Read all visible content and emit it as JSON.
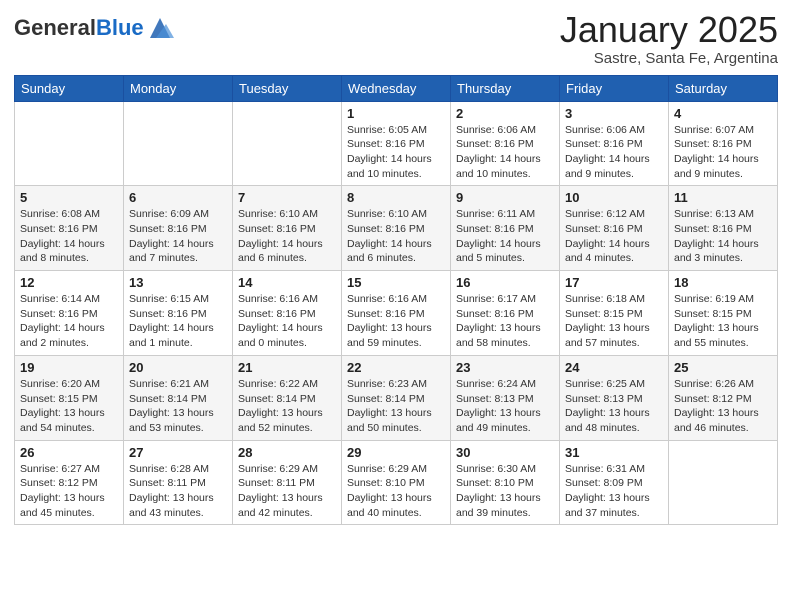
{
  "logo": {
    "general": "General",
    "blue": "Blue"
  },
  "title": "January 2025",
  "location": "Sastre, Santa Fe, Argentina",
  "days_of_week": [
    "Sunday",
    "Monday",
    "Tuesday",
    "Wednesday",
    "Thursday",
    "Friday",
    "Saturday"
  ],
  "weeks": [
    [
      {
        "day": "",
        "info": ""
      },
      {
        "day": "",
        "info": ""
      },
      {
        "day": "",
        "info": ""
      },
      {
        "day": "1",
        "info": "Sunrise: 6:05 AM\nSunset: 8:16 PM\nDaylight: 14 hours\nand 10 minutes."
      },
      {
        "day": "2",
        "info": "Sunrise: 6:06 AM\nSunset: 8:16 PM\nDaylight: 14 hours\nand 10 minutes."
      },
      {
        "day": "3",
        "info": "Sunrise: 6:06 AM\nSunset: 8:16 PM\nDaylight: 14 hours\nand 9 minutes."
      },
      {
        "day": "4",
        "info": "Sunrise: 6:07 AM\nSunset: 8:16 PM\nDaylight: 14 hours\nand 9 minutes."
      }
    ],
    [
      {
        "day": "5",
        "info": "Sunrise: 6:08 AM\nSunset: 8:16 PM\nDaylight: 14 hours\nand 8 minutes."
      },
      {
        "day": "6",
        "info": "Sunrise: 6:09 AM\nSunset: 8:16 PM\nDaylight: 14 hours\nand 7 minutes."
      },
      {
        "day": "7",
        "info": "Sunrise: 6:10 AM\nSunset: 8:16 PM\nDaylight: 14 hours\nand 6 minutes."
      },
      {
        "day": "8",
        "info": "Sunrise: 6:10 AM\nSunset: 8:16 PM\nDaylight: 14 hours\nand 6 minutes."
      },
      {
        "day": "9",
        "info": "Sunrise: 6:11 AM\nSunset: 8:16 PM\nDaylight: 14 hours\nand 5 minutes."
      },
      {
        "day": "10",
        "info": "Sunrise: 6:12 AM\nSunset: 8:16 PM\nDaylight: 14 hours\nand 4 minutes."
      },
      {
        "day": "11",
        "info": "Sunrise: 6:13 AM\nSunset: 8:16 PM\nDaylight: 14 hours\nand 3 minutes."
      }
    ],
    [
      {
        "day": "12",
        "info": "Sunrise: 6:14 AM\nSunset: 8:16 PM\nDaylight: 14 hours\nand 2 minutes."
      },
      {
        "day": "13",
        "info": "Sunrise: 6:15 AM\nSunset: 8:16 PM\nDaylight: 14 hours\nand 1 minute."
      },
      {
        "day": "14",
        "info": "Sunrise: 6:16 AM\nSunset: 8:16 PM\nDaylight: 14 hours\nand 0 minutes."
      },
      {
        "day": "15",
        "info": "Sunrise: 6:16 AM\nSunset: 8:16 PM\nDaylight: 13 hours\nand 59 minutes."
      },
      {
        "day": "16",
        "info": "Sunrise: 6:17 AM\nSunset: 8:16 PM\nDaylight: 13 hours\nand 58 minutes."
      },
      {
        "day": "17",
        "info": "Sunrise: 6:18 AM\nSunset: 8:15 PM\nDaylight: 13 hours\nand 57 minutes."
      },
      {
        "day": "18",
        "info": "Sunrise: 6:19 AM\nSunset: 8:15 PM\nDaylight: 13 hours\nand 55 minutes."
      }
    ],
    [
      {
        "day": "19",
        "info": "Sunrise: 6:20 AM\nSunset: 8:15 PM\nDaylight: 13 hours\nand 54 minutes."
      },
      {
        "day": "20",
        "info": "Sunrise: 6:21 AM\nSunset: 8:14 PM\nDaylight: 13 hours\nand 53 minutes."
      },
      {
        "day": "21",
        "info": "Sunrise: 6:22 AM\nSunset: 8:14 PM\nDaylight: 13 hours\nand 52 minutes."
      },
      {
        "day": "22",
        "info": "Sunrise: 6:23 AM\nSunset: 8:14 PM\nDaylight: 13 hours\nand 50 minutes."
      },
      {
        "day": "23",
        "info": "Sunrise: 6:24 AM\nSunset: 8:13 PM\nDaylight: 13 hours\nand 49 minutes."
      },
      {
        "day": "24",
        "info": "Sunrise: 6:25 AM\nSunset: 8:13 PM\nDaylight: 13 hours\nand 48 minutes."
      },
      {
        "day": "25",
        "info": "Sunrise: 6:26 AM\nSunset: 8:12 PM\nDaylight: 13 hours\nand 46 minutes."
      }
    ],
    [
      {
        "day": "26",
        "info": "Sunrise: 6:27 AM\nSunset: 8:12 PM\nDaylight: 13 hours\nand 45 minutes."
      },
      {
        "day": "27",
        "info": "Sunrise: 6:28 AM\nSunset: 8:11 PM\nDaylight: 13 hours\nand 43 minutes."
      },
      {
        "day": "28",
        "info": "Sunrise: 6:29 AM\nSunset: 8:11 PM\nDaylight: 13 hours\nand 42 minutes."
      },
      {
        "day": "29",
        "info": "Sunrise: 6:29 AM\nSunset: 8:10 PM\nDaylight: 13 hours\nand 40 minutes."
      },
      {
        "day": "30",
        "info": "Sunrise: 6:30 AM\nSunset: 8:10 PM\nDaylight: 13 hours\nand 39 minutes."
      },
      {
        "day": "31",
        "info": "Sunrise: 6:31 AM\nSunset: 8:09 PM\nDaylight: 13 hours\nand 37 minutes."
      },
      {
        "day": "",
        "info": ""
      }
    ]
  ]
}
